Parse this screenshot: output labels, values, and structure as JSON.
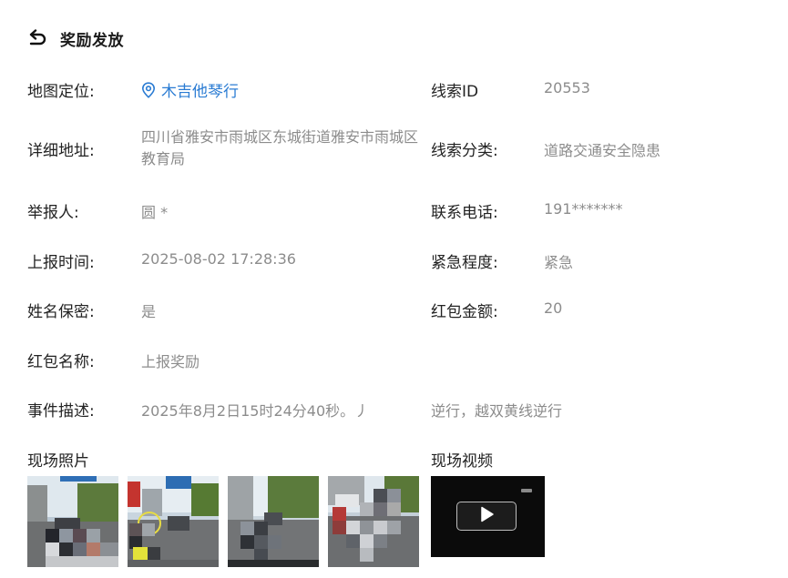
{
  "header": {
    "back_icon": "back-arrow-icon",
    "title": "奖励发放"
  },
  "fields": {
    "location": {
      "label": "地图定位:",
      "value": "木吉他琴行",
      "icon": "location-pin-icon",
      "color": "#2b7cd3"
    },
    "clue_id": {
      "label": "线索ID",
      "value": "20553"
    },
    "address": {
      "label": "详细地址:",
      "value": "四川省雅安市雨城区东城街道雅安市雨城区教育局"
    },
    "clue_category": {
      "label": "线索分类:",
      "value": "道路交通安全隐患"
    },
    "reporter": {
      "label": "举报人:",
      "value": "圆 *"
    },
    "phone": {
      "label": "联系电话:",
      "value": "191*******"
    },
    "report_time": {
      "label": "上报时间:",
      "value": "2025-08-02 17:28:36"
    },
    "urgency": {
      "label": "紧急程度:",
      "value": "紧急"
    },
    "anonymous": {
      "label": "姓名保密:",
      "value": "是"
    },
    "red_packet_amount": {
      "label": "红包金额:",
      "value": "20"
    },
    "red_packet_name": {
      "label": "红包名称:",
      "value": "上报奖励"
    },
    "event_desc": {
      "label": "事件描述:",
      "value_part1": "2025年8月2日15时24分40秒。丿",
      "value_part2": "逆行，越双黄线逆行"
    }
  },
  "photos": {
    "title": "现场照片",
    "count": 4
  },
  "video": {
    "title": "现场视频",
    "play_icon": "play-icon"
  }
}
